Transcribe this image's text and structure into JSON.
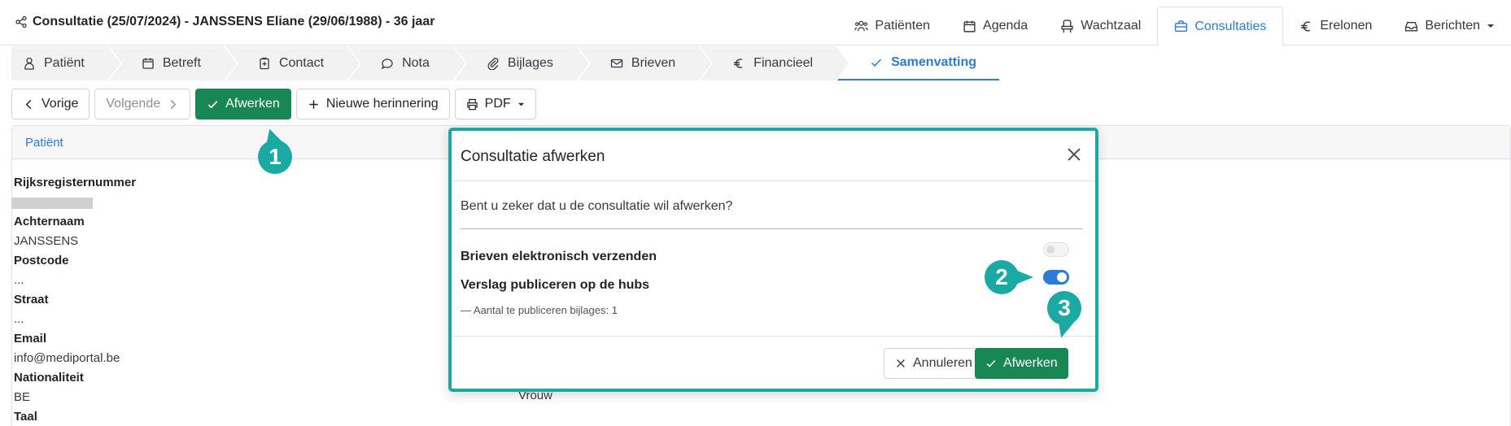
{
  "header": {
    "title": "Consultatie (25/07/2024) - JANSSENS Eliane (29/06/1988) - 36 jaar",
    "title_icon": "share-nodes-icon"
  },
  "nav": [
    {
      "label": "Patiënten",
      "icon": "users-icon"
    },
    {
      "label": "Agenda",
      "icon": "calendar-icon"
    },
    {
      "label": "Wachtzaal",
      "icon": "chair-icon"
    },
    {
      "label": "Consultaties",
      "icon": "briefcase-icon",
      "active": true
    },
    {
      "label": "Erelonen",
      "icon": "euro-icon"
    },
    {
      "label": "Berichten",
      "icon": "inbox-icon",
      "dropdown": true
    }
  ],
  "steps": [
    {
      "label": "Patiënt",
      "icon": "person-icon"
    },
    {
      "label": "Betreft",
      "icon": "calendar-icon"
    },
    {
      "label": "Contact",
      "icon": "clipboard-plus-icon"
    },
    {
      "label": "Nota",
      "icon": "comment-icon"
    },
    {
      "label": "Bijlages",
      "icon": "paperclip-icon"
    },
    {
      "label": "Brieven",
      "icon": "mail-icon"
    },
    {
      "label": "Financieel",
      "icon": "euro-icon"
    },
    {
      "label": "Samenvatting",
      "icon": "check-icon",
      "active": true
    }
  ],
  "actions": {
    "prev": "Vorige",
    "next": "Volgende",
    "finish": "Afwerken",
    "reminder": "Nieuwe herinnering",
    "pdf": "PDF"
  },
  "panel": {
    "title": "Patiënt",
    "fields": [
      {
        "label": "Rijksregisternummer",
        "value": ""
      },
      {
        "label": "Achternaam",
        "value": "JANSSENS"
      },
      {
        "label": "Postcode",
        "value": "..."
      },
      {
        "label": "Straat",
        "value": "..."
      },
      {
        "label": "Email",
        "value": "info@mediportal.be"
      },
      {
        "label": "Nationaliteit",
        "value": "BE"
      },
      {
        "label": "Taal",
        "value": ""
      }
    ],
    "gender_value": "Vrouw"
  },
  "modal": {
    "title": "Consultatie afwerken",
    "question": "Bent u zeker dat u de consultatie wil afwerken?",
    "option1": {
      "label": "Brieven elektronisch verzenden",
      "enabled": false
    },
    "option2": {
      "label": "Verslag publiceren op de hubs",
      "enabled": true
    },
    "sub": "—  Aantal te publiceren bijlages: 1",
    "cancel": "Annuleren",
    "confirm": "Afwerken"
  },
  "callouts": [
    "1",
    "2",
    "3"
  ],
  "colors": {
    "accent": "#2c7bd6",
    "success": "#198754",
    "callout": "#1aa9a3"
  }
}
